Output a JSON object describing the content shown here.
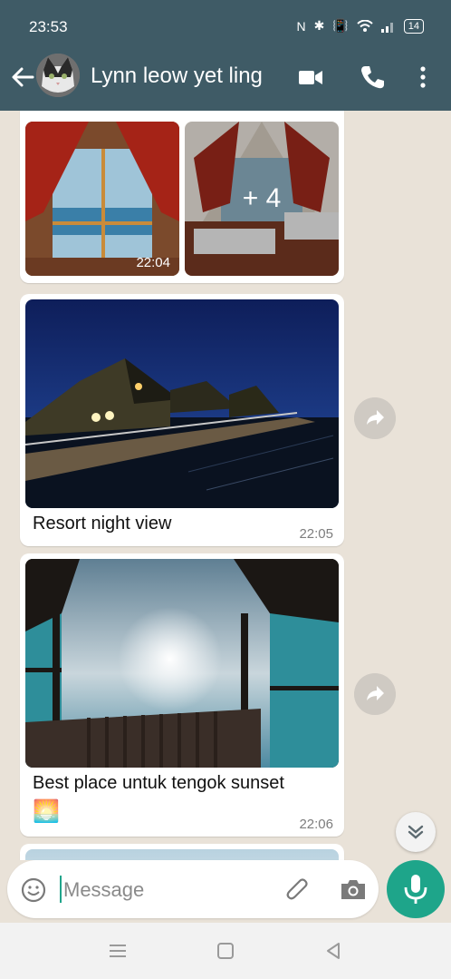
{
  "status_bar": {
    "time": "23:53",
    "battery": "14"
  },
  "header": {
    "contact_name": "Lynn leow yet ling"
  },
  "messages": [
    {
      "type": "album",
      "time": "22:04",
      "more_count": "+ 4"
    },
    {
      "type": "image",
      "caption": "Resort night view",
      "time": "22:05"
    },
    {
      "type": "image",
      "caption": "Best place untuk tengok sunset",
      "emoji": "🌅",
      "time": "22:06"
    }
  ],
  "composer": {
    "placeholder": "Message"
  },
  "colors": {
    "header": "#3f5b66",
    "accent": "#1ea58a",
    "chat_bg": "#e9e2d8"
  }
}
